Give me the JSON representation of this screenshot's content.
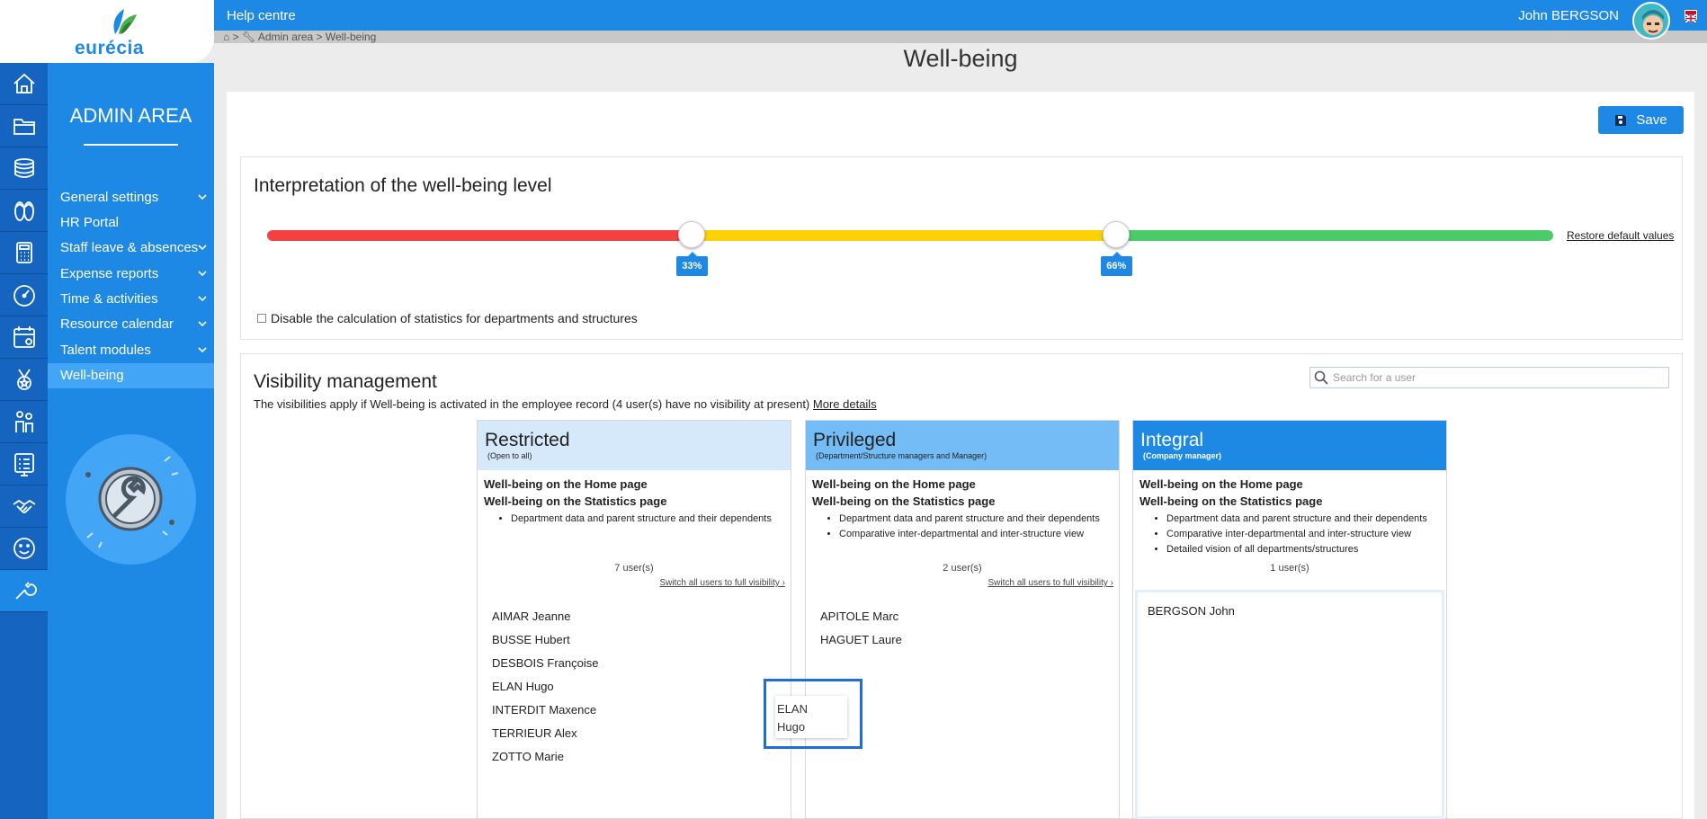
{
  "header": {
    "help_label": "Help centre",
    "user_name": "John  BERGSON"
  },
  "logo": {
    "text": "eurécia"
  },
  "breadcrumb": {
    "text": "Admin area > Well-being"
  },
  "page": {
    "title": "Well-being"
  },
  "sidebar": {
    "title": "ADMIN AREA",
    "icons": [
      "home-icon",
      "folder-icon",
      "coins-icon",
      "flip-flops-icon",
      "calculator-icon",
      "speedometer-icon",
      "calendar-icon",
      "medal-icon",
      "people-icon",
      "checklist-icon",
      "handshake-icon",
      "smiley-icon",
      "wrench-icon"
    ],
    "items": [
      {
        "label": "General settings",
        "expandable": true
      },
      {
        "label": "HR Portal",
        "expandable": false
      },
      {
        "label": "Staff leave & absences",
        "expandable": true
      },
      {
        "label": "Expense reports",
        "expandable": true
      },
      {
        "label": "Time & activities",
        "expandable": true
      },
      {
        "label": "Resource calendar",
        "expandable": true
      },
      {
        "label": "Talent modules",
        "expandable": true
      },
      {
        "label": "Well-being",
        "expandable": false,
        "active": true
      }
    ]
  },
  "toolbar": {
    "save_label": "Save"
  },
  "interpretation": {
    "title": "Interpretation of the well-being level",
    "threshold_low": "33%",
    "threshold_high": "66%",
    "threshold_low_value": 0.33,
    "threshold_high_value": 0.66,
    "restore_label": "Restore default values",
    "disable_label": "Disable the calculation of statistics for departments and structures",
    "colors": {
      "low": "#f44242",
      "mid": "#fcd206",
      "high": "#4ccb6a"
    }
  },
  "visibility": {
    "title": "Visibility management",
    "description": "The visibilities apply if Well-being is activated in the employee record (4 user(s) have no visibility at present)",
    "more_details": "More details",
    "search_placeholder": "Search for a user",
    "columns": [
      {
        "title": "Restricted",
        "subtitle": "(Open to all)",
        "feature1": "Well-being on the Home page",
        "feature2": "Well-being on the Statistics page",
        "bullets": [
          "Department data and parent structure and their dependents"
        ],
        "count": "7 user(s)",
        "switch_label": "Switch all users to full visibility",
        "users": [
          "AIMAR Jeanne",
          "BUSSE Hubert",
          "DESBOIS Françoise",
          "ELAN Hugo",
          "INTERDIT Maxence",
          "TERRIEUR Alex",
          "ZOTTO Marie"
        ],
        "header_color": "#d6e9fb"
      },
      {
        "title": "Privileged",
        "subtitle": "(Department/Structure managers and Manager)",
        "feature1": "Well-being on the Home page",
        "feature2": "Well-being on the Statistics page",
        "bullets": [
          "Department data and parent structure and their dependents",
          "Comparative inter-departmental and inter-structure view"
        ],
        "count": "2 user(s)",
        "switch_label": "Switch all users to full visibility",
        "users": [
          "APITOLE Marc",
          "HAGUET Laure"
        ],
        "header_color": "#74bcf6"
      },
      {
        "title": "Integral",
        "subtitle": "(Company manager)",
        "feature1": "Well-being on the Home page",
        "feature2": "Well-being on the Statistics page",
        "bullets": [
          "Department data and parent structure and their dependents",
          "Comparative inter-departmental and inter-structure view",
          "Detailed vision of all departments/structures"
        ],
        "count": "1 user(s)",
        "users": [
          "BERGSON John"
        ],
        "header_color": "#1e88e5"
      }
    ],
    "dragging": {
      "line1": "ELAN",
      "line2": "Hugo"
    }
  }
}
